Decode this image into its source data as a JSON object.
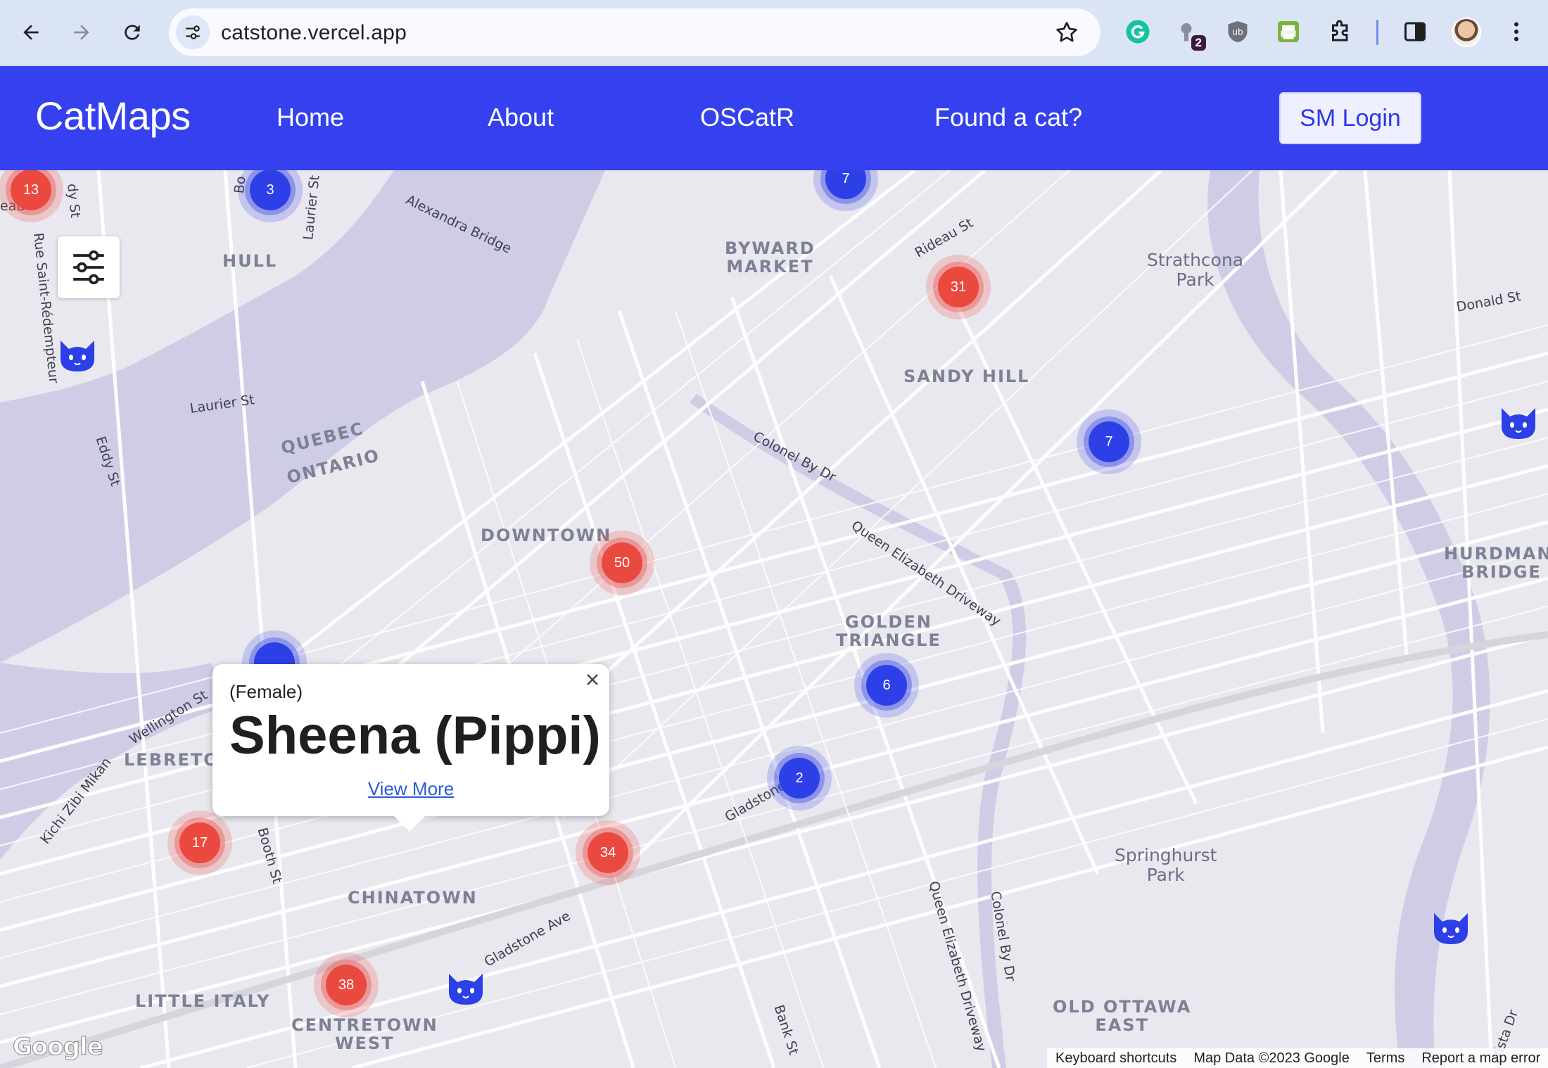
{
  "browser": {
    "url": "catstone.vercel.app",
    "extension_badge_count": "2"
  },
  "app": {
    "brand": "CatMaps",
    "nav": {
      "home": "Home",
      "about": "About",
      "oscatr": "OSCatR",
      "found": "Found a cat?"
    },
    "login_label": "SM Login"
  },
  "map": {
    "areas": {
      "hull": "HULL",
      "byward": "BYWARD\nMARKET",
      "sandy_hill": "SANDY HILL",
      "downtown": "DOWNTOWN",
      "golden_triangle": "GOLDEN\nTRIANGLE",
      "hurdman": "HURDMAN'\nBRIDGE",
      "lebreton": "LEBRETO",
      "chinatown": "CHINATOWN",
      "little_italy": "LITTLE ITALY",
      "centretown_west": "CENTRETOWN\nWEST",
      "old_ottawa_east": "OLD OTTAWA\nEAST",
      "quebec": "QUEBEC",
      "ontario": "ONTARIO"
    },
    "parks": {
      "strathcona": "Strathcona\nPark",
      "springhurst": "Springhurst\nPark"
    },
    "streets": {
      "alexandra": "Alexandra Bridge",
      "rideau": "Rideau St",
      "laurier_w": "Laurier St",
      "laurier_v": "Laurier St",
      "eddy": "Eddy St",
      "colonel_by": "Colonel By Dr",
      "qe_driveway": "Queen Elizabeth Driveway",
      "donald": "Donald St",
      "wellington": "Wellington St",
      "kichi": "Kichi Zibi Mikan",
      "gladstone1": "Gladstone Ave",
      "gladstone2": "Gladstone Ave",
      "booth": "Booth St",
      "bank": "Bank St",
      "qe_driveway2": "Queen Elizabeth Driveway",
      "colonel_by2": "Colonel By Dr",
      "vista": "Vista Dr",
      "redempteur": "Rue Saint-Rédempteur",
      "dly": "dy St",
      "bo": "Bo",
      "eau": "eau"
    },
    "clusters": [
      {
        "count": "13",
        "color": "red"
      },
      {
        "count": "3",
        "color": "blue"
      },
      {
        "count": "7",
        "color": "blue"
      },
      {
        "count": "31",
        "color": "red"
      },
      {
        "count": "7",
        "color": "blue"
      },
      {
        "count": "50",
        "color": "red"
      },
      {
        "count": "6",
        "color": "blue"
      },
      {
        "count": "2",
        "color": "blue"
      },
      {
        "count": "17",
        "color": "red"
      },
      {
        "count": "34",
        "color": "red"
      },
      {
        "count": "38",
        "color": "red"
      }
    ],
    "popup": {
      "sex": "(Female)",
      "name": "Sheena (Pippi)",
      "link": "View More"
    }
  },
  "footer": {
    "google": "Google",
    "shortcuts": "Keyboard shortcuts",
    "map_data": "Map Data ©2023 Google",
    "terms": "Terms",
    "report": "Report a map error"
  },
  "colors": {
    "brand_blue": "#3541ef",
    "cluster_red": "#e9493f",
    "cluster_blue": "#2d3fe6",
    "water": "#cfcde6"
  }
}
